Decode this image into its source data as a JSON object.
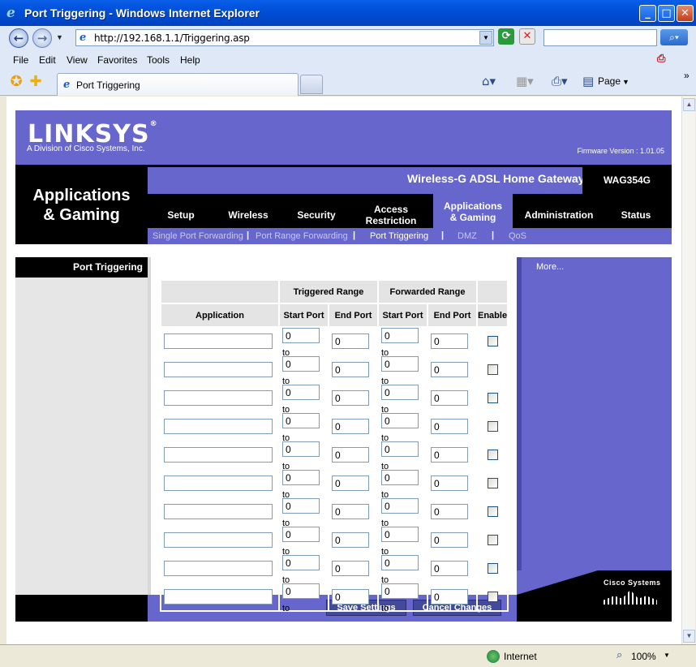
{
  "browser": {
    "window_title": "Port Triggering - Windows Internet Explorer",
    "url": "http://192.168.1.1/Triggering.asp",
    "menu": [
      "File",
      "Edit",
      "View",
      "Favorites",
      "Tools",
      "Help"
    ],
    "tab_title": "Port Triggering",
    "page_menu": "Page",
    "status_zone": "Internet",
    "zoom": "100%"
  },
  "router": {
    "logo": "LINKSYS",
    "logo_mark": "®",
    "tagline": "A Division of Cisco Systems, Inc.",
    "firmware": "Firmware Version : 1.01.05",
    "section_title_line1": "Applications",
    "section_title_line2": "& Gaming",
    "product_name": "Wireless-G ADSL Home Gateway",
    "model": "WAG354G",
    "tabs": [
      {
        "label1": "Setup",
        "label2": ""
      },
      {
        "label1": "Wireless",
        "label2": ""
      },
      {
        "label1": "Security",
        "label2": ""
      },
      {
        "label1": "Access",
        "label2": "Restriction"
      },
      {
        "label1": "Applications",
        "label2": "& Gaming"
      },
      {
        "label1": "Administration",
        "label2": ""
      },
      {
        "label1": "Status",
        "label2": ""
      }
    ],
    "subtabs": [
      "Single Port Forwarding",
      "Port Range Forwarding",
      "Port Triggering",
      "DMZ",
      "QoS"
    ],
    "sidebar_label": "Port Triggering",
    "more_link": "More...",
    "brand_footer": "Cisco Systems",
    "save_button": "Save Settings",
    "cancel_button": "Cancel Changes"
  },
  "table": {
    "group_triggered": "Triggered Range",
    "group_forwarded": "Forwarded Range",
    "col_application": "Application",
    "col_start": "Start Port",
    "col_end": "End Port",
    "col_enable": "Enable",
    "to_label": "to",
    "rows": [
      {
        "application": "",
        "trig_start": "0",
        "trig_end": "0",
        "fwd_start": "0",
        "fwd_end": "0",
        "enabled": false
      },
      {
        "application": "",
        "trig_start": "0",
        "trig_end": "0",
        "fwd_start": "0",
        "fwd_end": "0",
        "enabled": false
      },
      {
        "application": "",
        "trig_start": "0",
        "trig_end": "0",
        "fwd_start": "0",
        "fwd_end": "0",
        "enabled": false
      },
      {
        "application": "",
        "trig_start": "0",
        "trig_end": "0",
        "fwd_start": "0",
        "fwd_end": "0",
        "enabled": false
      },
      {
        "application": "",
        "trig_start": "0",
        "trig_end": "0",
        "fwd_start": "0",
        "fwd_end": "0",
        "enabled": false
      },
      {
        "application": "",
        "trig_start": "0",
        "trig_end": "0",
        "fwd_start": "0",
        "fwd_end": "0",
        "enabled": false
      },
      {
        "application": "",
        "trig_start": "0",
        "trig_end": "0",
        "fwd_start": "0",
        "fwd_end": "0",
        "enabled": false
      },
      {
        "application": "",
        "trig_start": "0",
        "trig_end": "0",
        "fwd_start": "0",
        "fwd_end": "0",
        "enabled": false
      },
      {
        "application": "",
        "trig_start": "0",
        "trig_end": "0",
        "fwd_start": "0",
        "fwd_end": "0",
        "enabled": false
      },
      {
        "application": "",
        "trig_start": "0",
        "trig_end": "0",
        "fwd_start": "0",
        "fwd_end": "0",
        "enabled": false
      }
    ]
  },
  "colors": {
    "linksys_purple": "#6666cc",
    "xp_title_blue": "#0050d8",
    "button_navy": "#434a9a"
  }
}
